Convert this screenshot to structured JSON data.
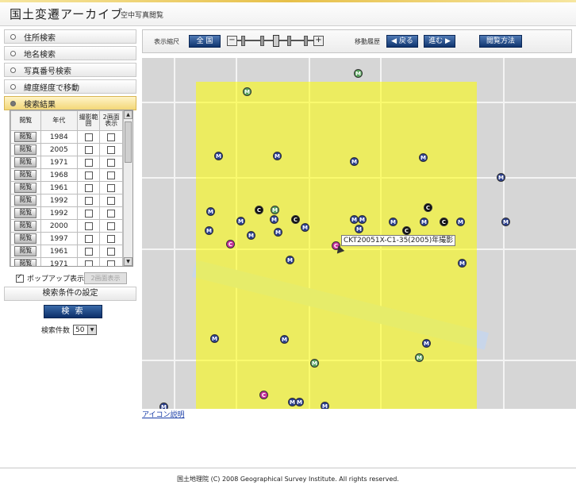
{
  "header": {
    "title": "国土変遷アーカイブ",
    "subtitle": "空中写真閲覧"
  },
  "sidebar": {
    "items": [
      {
        "label": "住所検索",
        "active": false
      },
      {
        "label": "地名検索",
        "active": false
      },
      {
        "label": "写真番号検索",
        "active": false
      },
      {
        "label": "緯度経度で移動",
        "active": false
      },
      {
        "label": "検索結果",
        "active": true
      }
    ]
  },
  "results": {
    "headers": [
      "閲覧",
      "年代",
      "撮影範囲",
      "2画面表示"
    ],
    "button_label": "閲覧",
    "years": [
      "1984",
      "2005",
      "1971",
      "1968",
      "1961",
      "1992",
      "1992",
      "2000",
      "1997",
      "1961",
      "1971"
    ]
  },
  "popup": {
    "label": "ポップアップ表示",
    "dual_button": "2画面表示"
  },
  "conditions_label": "検索条件の設定",
  "search_button": "検 索",
  "count": {
    "label": "検索件数",
    "value": "50"
  },
  "toolbar": {
    "scale_label": "表示縮尺",
    "full_button": "全 国",
    "minus": "−",
    "plus": "+",
    "history_label": "移動履歴",
    "back_button": "◀ 戻る",
    "forward_button": "進む ▶",
    "help_button": "閲覧方法"
  },
  "map": {
    "overlay_color": "#ffff00",
    "tooltip": "CKT20051X-C1-35(2005)年撮影"
  },
  "icon_link": "アイコン説明",
  "footer": "国土地理院 (C) 2008 Geographical Survey Institute. All rights reserved."
}
